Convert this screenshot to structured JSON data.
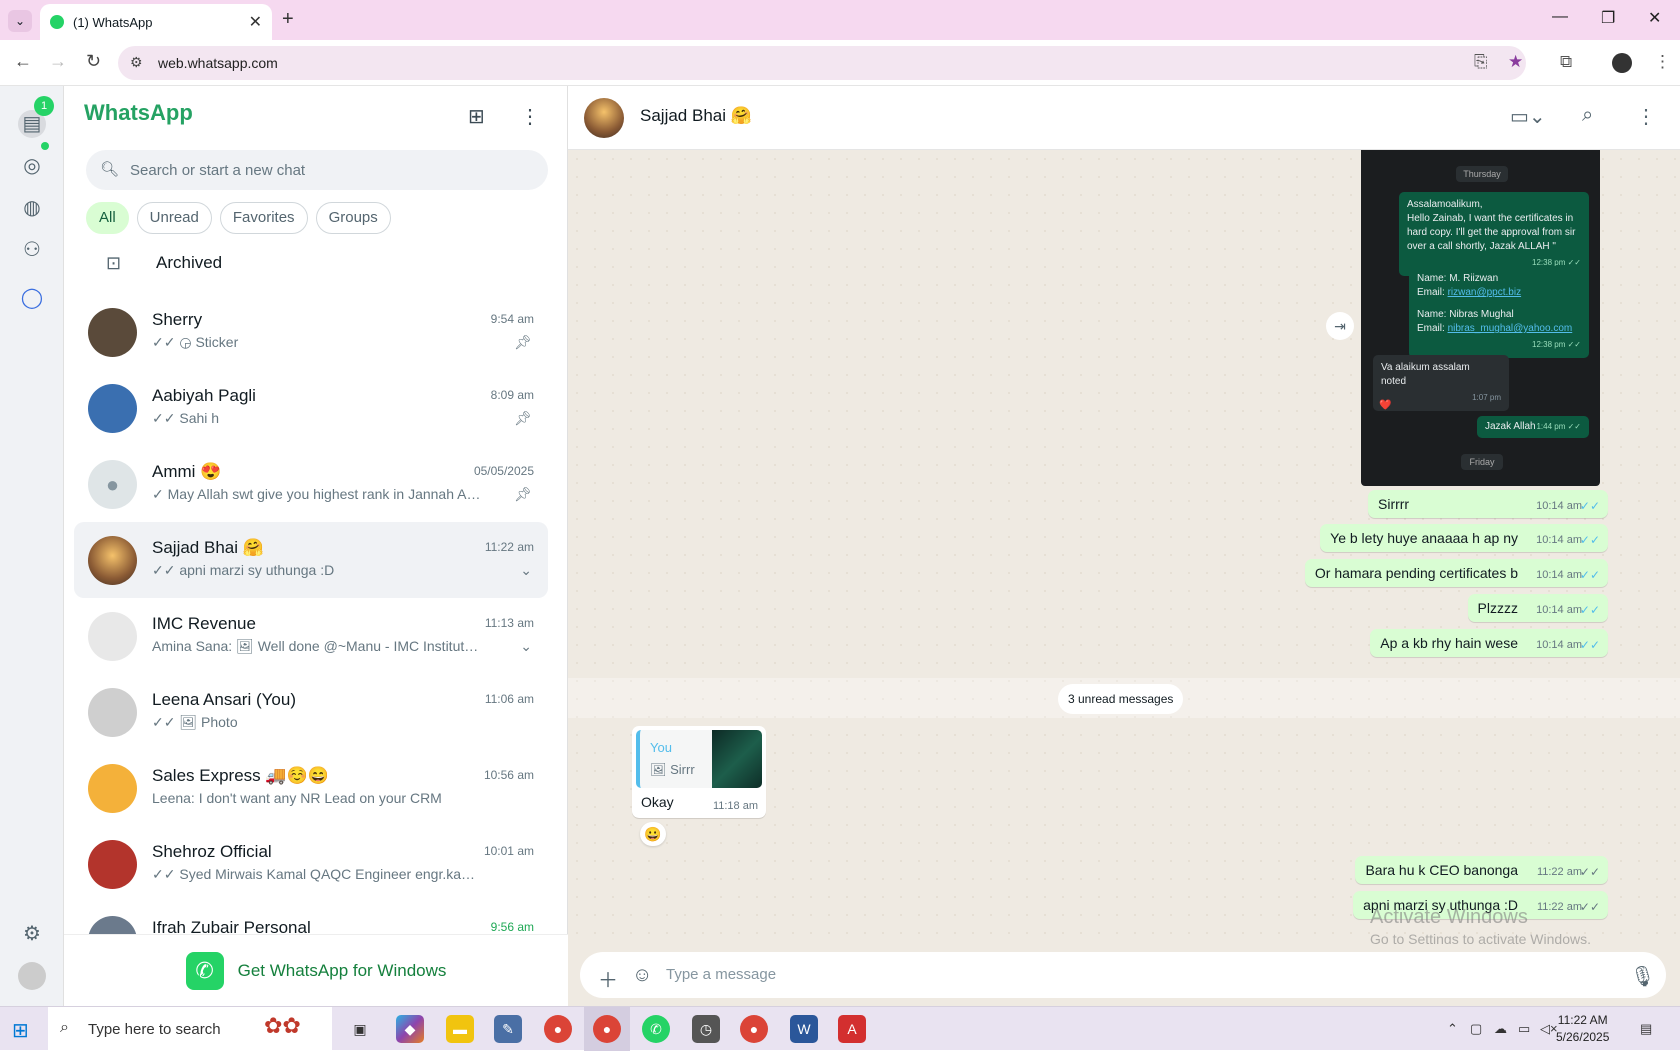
{
  "browser": {
    "tab_title": "(1) WhatsApp",
    "url": "web.whatsapp.com"
  },
  "rail": {
    "chats_badge": "1"
  },
  "sidebar": {
    "brand": "WhatsApp",
    "search_placeholder": "Search or start a new chat",
    "filters": [
      "All",
      "Unread",
      "Favorites",
      "Groups"
    ],
    "archived_label": "Archived",
    "chats": [
      {
        "name": "Sherry",
        "time": "9:54 am",
        "preview": "✓✓ ◶ Sticker",
        "pinned": true,
        "avatar_color": "#5a4a3a"
      },
      {
        "name": "Aabiyah Pagli",
        "time": "8:09 am",
        "preview": "✓✓ Sahi h",
        "pinned": true,
        "avatar_color": "#3a6fb0"
      },
      {
        "name": "Ammi 😍",
        "time": "05/05/2025",
        "preview": "✓ May Allah swt give you highest rank in Jannah  Ame...",
        "pinned": true,
        "avatar_color": "#dfe5e7"
      },
      {
        "name": "Sajjad Bhai 🤗",
        "time": "11:22 am",
        "preview": "✓✓ apni marzi sy uthunga :D",
        "pinned": false,
        "avatar_color": "#b07a44"
      },
      {
        "name": "IMC Revenue",
        "time": "11:13 am",
        "preview": "Amina Sana: 🖼 Well done @~Manu - IMC Institute, A...",
        "pinned": false,
        "avatar_color": "#e8e8e8"
      },
      {
        "name": "Leena Ansari (You)",
        "time": "11:06 am",
        "preview": "✓✓ 🖼 Photo",
        "pinned": false,
        "avatar_color": "#cfcfcf"
      },
      {
        "name": "Sales Express 🚚☺️😄",
        "time": "10:56 am",
        "preview": "Leena: I don't want any NR Lead on your CRM",
        "pinned": false,
        "avatar_color": "#f4b13a"
      },
      {
        "name": "Shehroz Official",
        "time": "10:01 am",
        "preview": "✓✓ Syed Mirwais Kamal QAQC Engineer engr.kamalshah@...",
        "pinned": false,
        "avatar_color": "#b3342c"
      },
      {
        "name": "Ifrah Zubair Personal",
        "time": "9:56 am",
        "preview": "",
        "pinned": false,
        "avatar_color": "#6b7a8c"
      }
    ],
    "promo": "Get WhatsApp for Windows"
  },
  "chat": {
    "contact_name": "Sajjad Bhai 🤗",
    "screenshot": {
      "day1": "Thursday",
      "msg1": "Assalamoalikum,\nHello Zainab, I want the certificates in hard copy. I'll get the approval from sir over a call shortly, Jazak ALLAH \"",
      "msg1_time": "12:38 pm ✓✓",
      "names_block_1": "Name: M. Riizwan",
      "email_label": "Email: ",
      "email_1": "rizwan@ppct.biz",
      "names_block_2": "Name: Nibras Mughal",
      "email_2": "nibras_mughal@yahoo.com",
      "msg2_time": "12:38 pm ✓✓",
      "reply": "Va alaikum assalam\nnoted",
      "reply_time": "1:07 pm",
      "heart": "❤️",
      "jazak": "Jazak Allah",
      "jazak_time": "1:44 pm ✓✓",
      "day2": "Friday"
    },
    "outgoing": [
      {
        "text": "Sirrrr",
        "time": "10:14 am"
      },
      {
        "text": "Ye b lety huye anaaaa h ap ny",
        "time": "10:14 am"
      },
      {
        "text": "Or hamara pending certificates b",
        "time": "10:14 am"
      },
      {
        "text": "Plzzzz",
        "time": "10:14 am"
      },
      {
        "text": "Ap a kb rhy hain wese",
        "time": "10:14 am"
      }
    ],
    "unread_label": "3 unread messages",
    "incoming": {
      "quote_author": "You",
      "quote_text": "🖼 Sirrr",
      "text": "Okay",
      "time": "11:18 am",
      "reaction": "😀"
    },
    "latest": [
      {
        "text": "Bara hu k CEO banonga",
        "time": "11:22 am"
      },
      {
        "text": "apni marzi sy uthunga :D",
        "time": "11:22 am"
      }
    ],
    "composer_placeholder": "Type a message"
  },
  "watermark": {
    "line1": "Activate Windows",
    "line2": "Go to Settings to activate Windows."
  },
  "taskbar": {
    "search_placeholder": "Type here to search",
    "time": "11:22 AM",
    "date": "5/26/2025"
  }
}
